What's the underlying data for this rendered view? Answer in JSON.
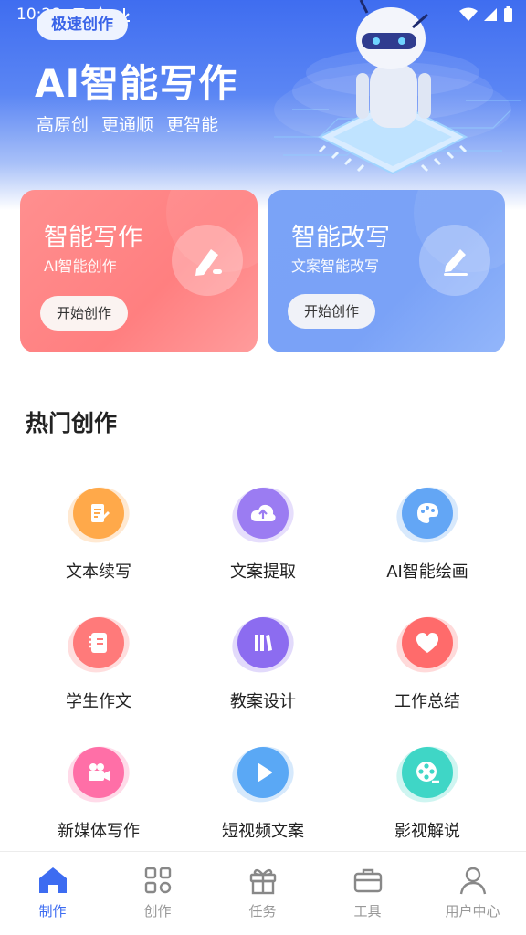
{
  "status_bar": {
    "time": "10:28"
  },
  "hero": {
    "badge": "极速创作",
    "title": "AI智能写作",
    "subtitle": "高原创  更通顺  更智能"
  },
  "cards": [
    {
      "title": "智能写作",
      "subtitle": "AI智能创作",
      "button": "开始创作",
      "icon": "pencil-icon",
      "color": "#ff8585"
    },
    {
      "title": "智能改写",
      "subtitle": "文案智能改写",
      "button": "开始创作",
      "icon": "edit-icon",
      "color": "#7aa3f7"
    }
  ],
  "section": {
    "title": "热门创作"
  },
  "tools": [
    {
      "label": "文本续写",
      "icon": "document-edit-icon",
      "color": "#ffa94a"
    },
    {
      "label": "文案提取",
      "icon": "cloud-upload-icon",
      "color": "#9b7cf2"
    },
    {
      "label": "AI智能绘画",
      "icon": "palette-icon",
      "color": "#63a6f5"
    },
    {
      "label": "学生作文",
      "icon": "notebook-icon",
      "color": "#ff7a7a"
    },
    {
      "label": "教案设计",
      "icon": "books-icon",
      "color": "#8c6cf0"
    },
    {
      "label": "工作总结",
      "icon": "heart-icon",
      "color": "#ff6b6b"
    },
    {
      "label": "新媒体写作",
      "icon": "video-camera-icon",
      "color": "#ff6fa7"
    },
    {
      "label": "短视频文案",
      "icon": "play-icon",
      "color": "#5aa8f5"
    },
    {
      "label": "影视解说",
      "icon": "film-reel-icon",
      "color": "#3fd6c6"
    }
  ],
  "nav": [
    {
      "label": "制作",
      "icon": "home-icon",
      "active": true
    },
    {
      "label": "创作",
      "icon": "grid-icon",
      "active": false
    },
    {
      "label": "任务",
      "icon": "gift-icon",
      "active": false
    },
    {
      "label": "工具",
      "icon": "briefcase-icon",
      "active": false
    },
    {
      "label": "用户中心",
      "icon": "user-icon",
      "active": false
    }
  ],
  "colors": {
    "primary": "#3d6cf1",
    "inactive": "#999999"
  }
}
